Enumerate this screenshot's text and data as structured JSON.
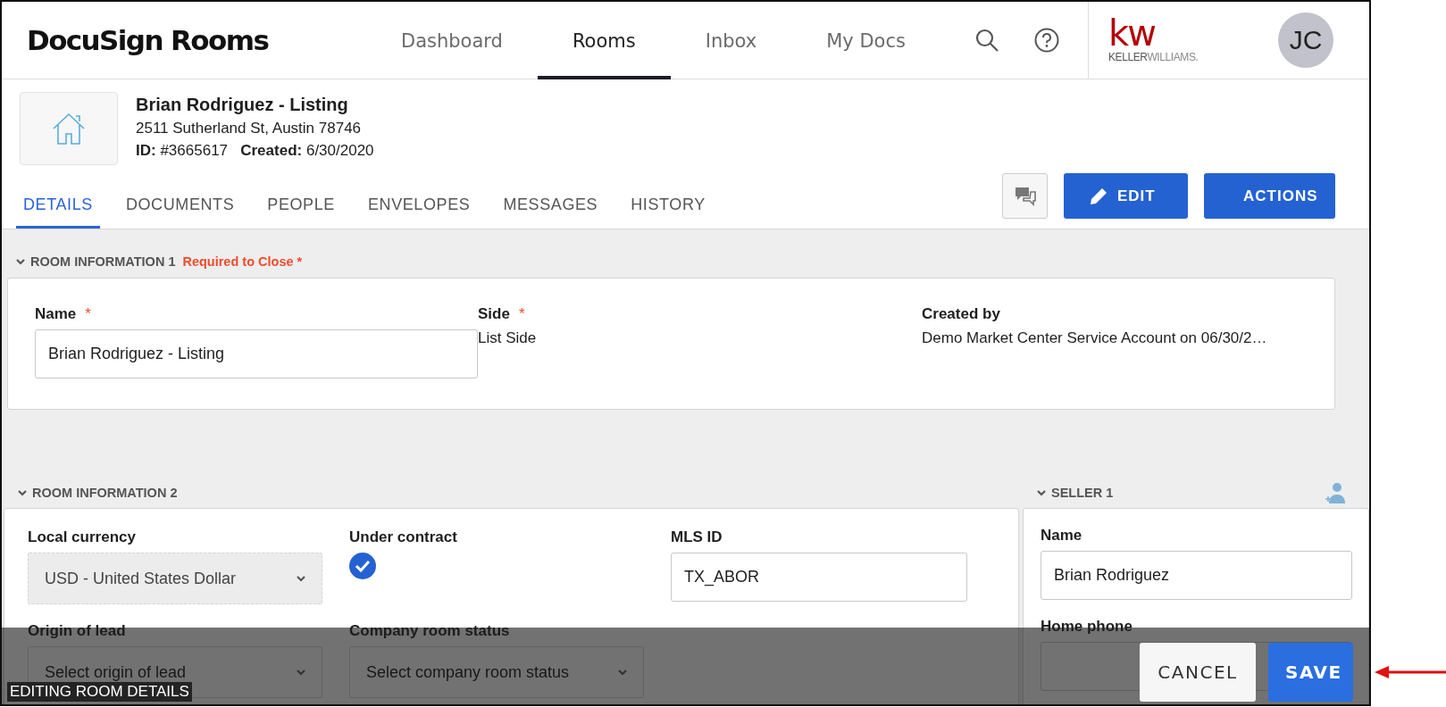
{
  "header": {
    "logo": "DocuSign Rooms",
    "nav": [
      {
        "label": "Dashboard",
        "selected": false
      },
      {
        "label": "Rooms",
        "selected": true
      },
      {
        "label": "Inbox",
        "selected": false
      },
      {
        "label": "My Docs",
        "selected": false
      }
    ],
    "brand_mark": "kw",
    "brand_name": "**KELLER**WILLIAMS.",
    "avatar": "JC"
  },
  "room": {
    "title": "Brian Rodriguez - Listing",
    "address": "2511 Sutherland St, Austin 78746",
    "id_label": "ID:",
    "id": "#3665617",
    "created_label": "Created:",
    "created": "6/30/2020"
  },
  "tabs": [
    {
      "label": "DETAILS",
      "selected": true
    },
    {
      "label": "DOCUMENTS",
      "selected": false
    },
    {
      "label": "PEOPLE",
      "selected": false
    },
    {
      "label": "ENVELOPES",
      "selected": false
    },
    {
      "label": "MESSAGES",
      "selected": false
    },
    {
      "label": "HISTORY",
      "selected": false
    }
  ],
  "toolbar": [
    {
      "kind": "chat"
    },
    {
      "kind": "edit",
      "label": "EDIT"
    },
    {
      "kind": "actions",
      "label": "ACTIONS"
    }
  ],
  "section_1": {
    "title": "ROOM INFORMATION 1",
    "note": "Required to Close *",
    "fields": [
      {
        "label": "Name",
        "required_mark": "*",
        "kind": "input",
        "value": "Brian Rodriguez - Listing"
      },
      {
        "label": "Side",
        "required_mark": "*",
        "kind": "text",
        "value": "List Side"
      },
      {
        "label": "Created by",
        "kind": "text",
        "value": "Demo Market Center Service Account on 06/30/2…"
      }
    ]
  },
  "section_2": {
    "title": "ROOM INFORMATION 2",
    "fields": [
      {
        "label": "Local currency",
        "kind": "select",
        "disabled": true,
        "value": "USD - United States Dollar"
      },
      {
        "label": "Under contract",
        "kind": "checkbox",
        "checked": true
      },
      {
        "label": "MLS ID",
        "kind": "input",
        "value": "TX_ABOR"
      },
      {
        "label": "Origin of lead",
        "kind": "select",
        "placeholder": "Select origin of lead"
      },
      {
        "label": "Company room status",
        "kind": "select",
        "placeholder": "Select company room status"
      }
    ]
  },
  "seller": {
    "title": "SELLER 1",
    "fields": [
      {
        "label": "Name",
        "kind": "input",
        "value": "Brian Rodriguez"
      },
      {
        "label": "Home phone",
        "kind": "input"
      }
    ]
  },
  "bottom_bar": {
    "title": "EDITING ROOM DETAILS",
    "buttons": [
      {
        "label": "CANCEL",
        "kind": "secondary"
      },
      {
        "label": "SAVE",
        "kind": "primary"
      }
    ]
  }
}
